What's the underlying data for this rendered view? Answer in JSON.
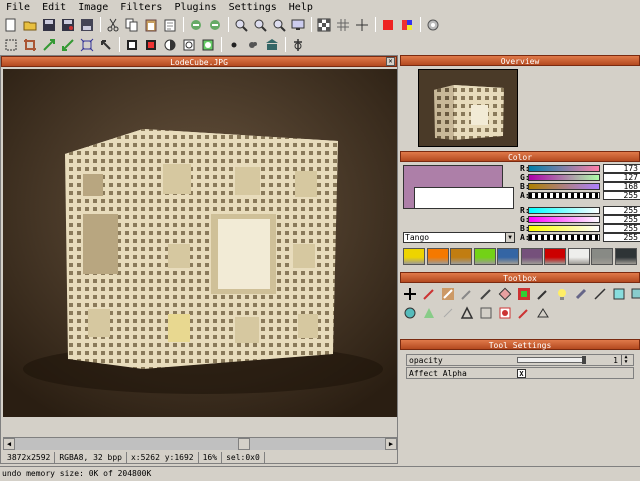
{
  "menu": [
    "File",
    "Edit",
    "Image",
    "Filters",
    "Plugins",
    "Settings",
    "Help"
  ],
  "image_window": {
    "title": "LodeCube.JPG"
  },
  "status": {
    "size": "3872x2592",
    "format": "RGBA8, 32 bpp",
    "coords": "x:5262 y:1692",
    "zoom": "16%",
    "selection": "sel:0x0"
  },
  "overview": {
    "title": "Overview"
  },
  "color": {
    "title": "Color",
    "primary_hex": "#ad7fa8",
    "secondary_hex": "#ffffff",
    "primary": [
      {
        "label": "R:",
        "value": "173"
      },
      {
        "label": "G:",
        "value": "127"
      },
      {
        "label": "B:",
        "value": "168"
      },
      {
        "label": "A:",
        "value": "255"
      }
    ],
    "secondary": [
      {
        "label": "R:",
        "value": "255"
      },
      {
        "label": "G:",
        "value": "255"
      },
      {
        "label": "B:",
        "value": "255"
      },
      {
        "label": "A:",
        "value": "255"
      }
    ],
    "palette_name": "Tango",
    "swatches": [
      "#edd400",
      "#f57900",
      "#c17d11",
      "#73d216",
      "#3465a4",
      "#75507b",
      "#cc0000",
      "#eeeeec",
      "#888a85",
      "#2e3436"
    ]
  },
  "toolbox": {
    "title": "Toolbox"
  },
  "tool_settings": {
    "title": "Tool Settings",
    "opacity_label": "opacity",
    "opacity_value": "1",
    "affect_alpha_label": "Affect Alpha",
    "affect_alpha_mark": "X"
  },
  "undo": {
    "text": "undo memory size: 0K of 204800K"
  }
}
